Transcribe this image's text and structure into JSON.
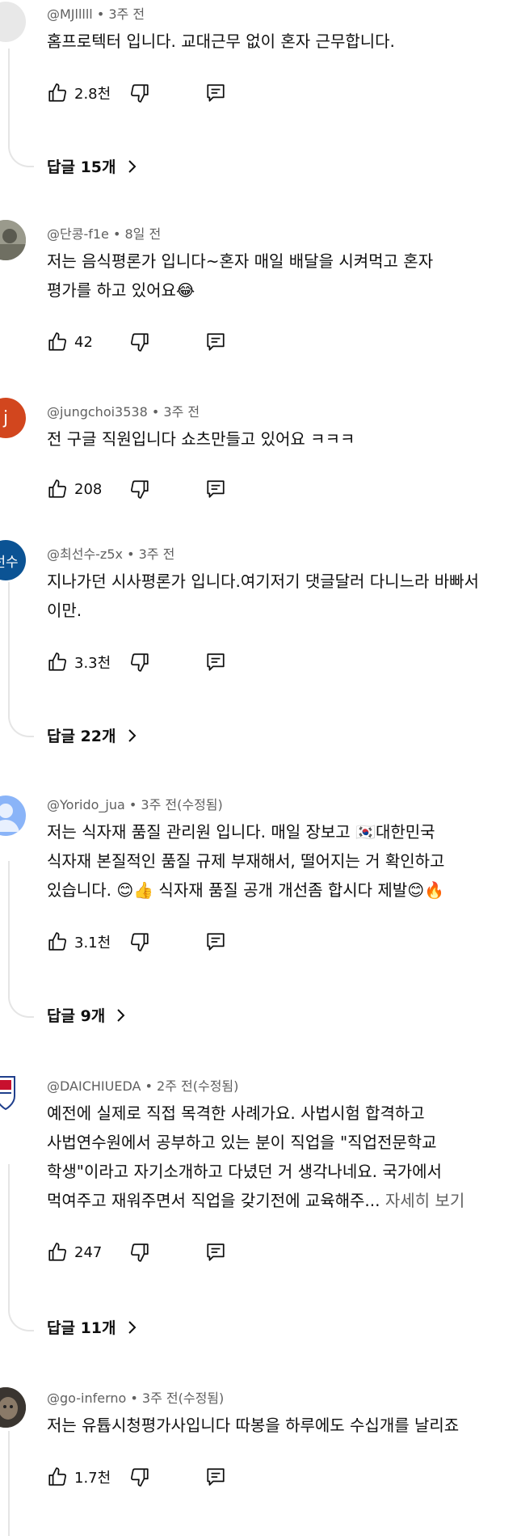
{
  "comments": [
    {
      "handle": "@MJlllll",
      "time": "3주 전",
      "lines": [
        "홈프로텍터 입니다. 교대근무 없이 혼자 근무합니다."
      ],
      "likes": "2.8천",
      "replies": "답글 15개"
    },
    {
      "handle": "@단콩-f1e",
      "time": "8일 전",
      "lines": [
        "저는 음식평론가 입니다~혼자 매일 배달을 시켜먹고 혼자",
        "평가를 하고 있어요😂"
      ],
      "likes": "42"
    },
    {
      "handle": "@jungchoi3538",
      "time": "3주 전",
      "avatar_letter": "j",
      "avatar_color": "#d2461e",
      "lines": [
        "전 구글 직원입니다  쇼츠만들고 있어요 ㅋㅋㅋ"
      ],
      "likes": "208"
    },
    {
      "handle": "@최선수-z5x",
      "time": "3주 전",
      "avatar_letter": "선수",
      "avatar_color": "#0b5394",
      "lines": [
        "지나가던 시사평론가 입니다.여기저기 댓글달러 다니느라 바빠서",
        "이만."
      ],
      "likes": "3.3천",
      "replies": "답글 22개"
    },
    {
      "handle": "@Yorido_jua",
      "time": "3주 전(수정됨)",
      "lines": [
        "저는 식자재 품질 관리원 입니다. 매일 장보고 🇰🇷대한민국",
        "식자재 본질적인 품질 규제 부재해서, 떨어지는 거 확인하고",
        "있습니다. 😊👍 식자재 품질 공개 개선좀 합시다 제발😊🔥"
      ],
      "likes": "3.1천",
      "replies": "답글 9개"
    },
    {
      "handle": "@DAICHIUEDA",
      "time": "2주 전(수정됨)",
      "lines": [
        "예전에 실제로 직접 목격한 사례가요. 사법시험 합격하고",
        "사법연수원에서 공부하고 있는 분이 직업을 \"직업전문학교",
        "학생\"이라고 자기소개하고 다녔던 거 생각나네요. 국가에서",
        "먹여주고 재워주면서 직업을 갖기전에 교육해주..."
      ],
      "more": "자세히 보기",
      "likes": "247",
      "replies": "답글 11개"
    },
    {
      "handle": "@go-inferno",
      "time": "3주 전(수정됨)",
      "lines": [
        "저는 유튭시청평가사입니다 따봉을 하루에도 수십개를 날리죠"
      ],
      "likes": "1.7천"
    }
  ],
  "separator": " • "
}
